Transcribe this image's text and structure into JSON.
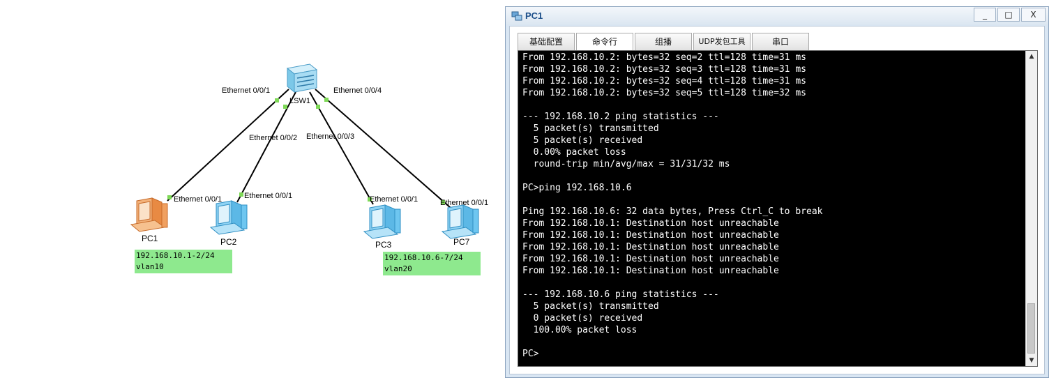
{
  "topology": {
    "switch": {
      "name": "LSW1"
    },
    "ports": {
      "sw_p1": "Ethernet 0/0/1",
      "sw_p2": "Ethernet 0/0/2",
      "sw_p3": "Ethernet 0/0/3",
      "sw_p4": "Ethernet 0/0/4",
      "pc1_port": "Ethernet 0/0/1",
      "pc2_port": "Ethernet 0/0/1",
      "pc3_port": "Ethernet 0/0/1",
      "pc7_port": "Ethernet 0/0/1"
    },
    "pcs": {
      "pc1": "PC1",
      "pc2": "PC2",
      "pc3": "PC3",
      "pc7": "PC7"
    },
    "notes": {
      "left": "192.168.10.1-2/24\nvlan10",
      "right": "192.168.10.6-7/24\nvlan20"
    },
    "colors": {
      "link": "#000000",
      "port_dot": "#7ed957",
      "note_bg": "#8ee98e",
      "pc1": "#f0a060",
      "pc_other": "#6ec6f0"
    }
  },
  "window": {
    "title": "PC1",
    "controls": {
      "minimize": "_",
      "maximize": "□",
      "close": "X"
    },
    "tabs": [
      "基础配置",
      "命令行",
      "组播",
      "UDP发包工具",
      "串口"
    ],
    "active_tab": "命令行",
    "terminal_lines": [
      "From 192.168.10.2: bytes=32 seq=2 ttl=128 time=31 ms",
      "From 192.168.10.2: bytes=32 seq=3 ttl=128 time=31 ms",
      "From 192.168.10.2: bytes=32 seq=4 ttl=128 time=31 ms",
      "From 192.168.10.2: bytes=32 seq=5 ttl=128 time=32 ms",
      "",
      "--- 192.168.10.2 ping statistics ---",
      "  5 packet(s) transmitted",
      "  5 packet(s) received",
      "  0.00% packet loss",
      "  round-trip min/avg/max = 31/31/32 ms",
      "",
      "PC>ping 192.168.10.6",
      "",
      "Ping 192.168.10.6: 32 data bytes, Press Ctrl_C to break",
      "From 192.168.10.1: Destination host unreachable",
      "From 192.168.10.1: Destination host unreachable",
      "From 192.168.10.1: Destination host unreachable",
      "From 192.168.10.1: Destination host unreachable",
      "From 192.168.10.1: Destination host unreachable",
      "",
      "--- 192.168.10.6 ping statistics ---",
      "  5 packet(s) transmitted",
      "  0 packet(s) received",
      "  100.00% packet loss",
      "",
      "PC>"
    ]
  }
}
